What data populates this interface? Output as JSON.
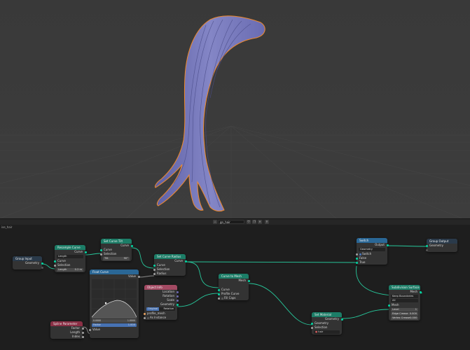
{
  "header": {
    "editor_label": "Geometry Nodes",
    "tree_name": "gn_hair",
    "pin_label": "",
    "partial_label": "ise_hair"
  },
  "nodes": {
    "group_input": {
      "title": "Group Input",
      "out_geometry": "Geometry"
    },
    "resample": {
      "title": "Resample Curve",
      "out_curve": "Curve",
      "mode": "Length",
      "in_curve": "Curve",
      "in_selection": "Selection",
      "length_label": "Length",
      "length_value": "0.2 m"
    },
    "set_curve_tilt": {
      "title": "Set Curve Tilt",
      "out_curve": "Curve",
      "in_curve": "Curve",
      "in_selection": "Selection",
      "tilt_label": "Tilt",
      "tilt_value": "90°"
    },
    "float_curve": {
      "title": "Float Curve",
      "out_value": "Value",
      "c_value": "1.0000",
      "c_value2": "0.0000",
      "factor_label": "Factor",
      "factor_value": "1.000",
      "in_value": "Value"
    },
    "spline_param": {
      "title": "Spline Parameter",
      "factor": "Factor",
      "length": "Length",
      "index": "Index"
    },
    "set_radius": {
      "title": "Set Curve Radius",
      "out_curve": "Curve",
      "in_curve": "Curve",
      "in_selection": "Selection",
      "in_radius": "Radius"
    },
    "object_info": {
      "title": "Object Info",
      "location": "Location",
      "rotation": "Rotation",
      "scale": "Scale",
      "geometry": "Geometry",
      "original": "Original",
      "relative": "Relative",
      "object_value": "profile_mesh",
      "as_instance": "As Instance"
    },
    "curve_to_mesh": {
      "title": "Curve to Mesh",
      "out_mesh": "Mesh",
      "in_curve": "Curve",
      "in_profile": "Profile Curve",
      "fill_caps": "Fill Caps"
    },
    "switch": {
      "title": "Switch",
      "out_output": "Output",
      "type": "Geometry",
      "switch_label": "Switch",
      "in_false": "False",
      "in_true": "True"
    },
    "group_output": {
      "title": "Group Output",
      "in_geometry": "Geometry"
    },
    "set_material": {
      "title": "Set Material",
      "out_geometry": "Geometry",
      "in_geometry": "Geometry",
      "in_selection": "Selection",
      "material": "hair"
    },
    "subdivision": {
      "title": "Subdivision Surface",
      "out_mesh": "Mesh",
      "uv_smooth": "Keep Boundaries",
      "boundary": "All",
      "in_mesh": "Mesh",
      "level_label": "Level",
      "level_value": "1",
      "edge_crease": "Edge Crease",
      "edge_crease_val": "0.000",
      "vertex_crease": "Vertex Crease",
      "vertex_crease_val": "0.000"
    }
  },
  "colors": {
    "geometry_socket": "#00d6a3",
    "link": "#27c79b",
    "mesh_fill": "#7d7fbd",
    "selection_outline": "#f08a2c"
  }
}
